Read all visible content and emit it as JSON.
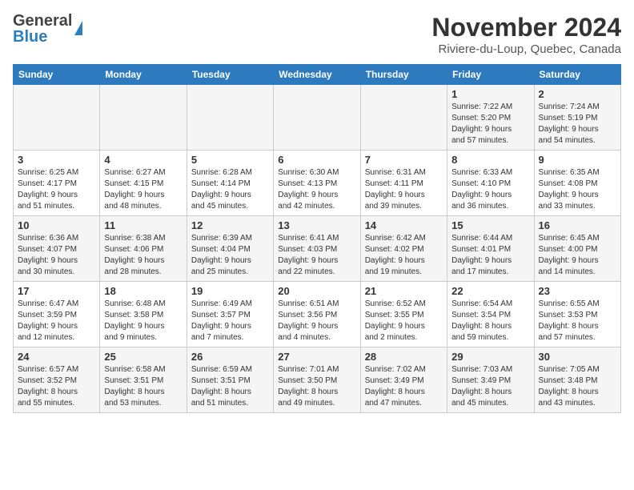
{
  "header": {
    "logo_general": "General",
    "logo_blue": "Blue",
    "month_title": "November 2024",
    "location": "Riviere-du-Loup, Quebec, Canada"
  },
  "weekdays": [
    "Sunday",
    "Monday",
    "Tuesday",
    "Wednesday",
    "Thursday",
    "Friday",
    "Saturday"
  ],
  "weeks": [
    [
      {
        "day": "",
        "info": ""
      },
      {
        "day": "",
        "info": ""
      },
      {
        "day": "",
        "info": ""
      },
      {
        "day": "",
        "info": ""
      },
      {
        "day": "",
        "info": ""
      },
      {
        "day": "1",
        "info": "Sunrise: 7:22 AM\nSunset: 5:20 PM\nDaylight: 9 hours\nand 57 minutes."
      },
      {
        "day": "2",
        "info": "Sunrise: 7:24 AM\nSunset: 5:19 PM\nDaylight: 9 hours\nand 54 minutes."
      }
    ],
    [
      {
        "day": "3",
        "info": "Sunrise: 6:25 AM\nSunset: 4:17 PM\nDaylight: 9 hours\nand 51 minutes."
      },
      {
        "day": "4",
        "info": "Sunrise: 6:27 AM\nSunset: 4:15 PM\nDaylight: 9 hours\nand 48 minutes."
      },
      {
        "day": "5",
        "info": "Sunrise: 6:28 AM\nSunset: 4:14 PM\nDaylight: 9 hours\nand 45 minutes."
      },
      {
        "day": "6",
        "info": "Sunrise: 6:30 AM\nSunset: 4:13 PM\nDaylight: 9 hours\nand 42 minutes."
      },
      {
        "day": "7",
        "info": "Sunrise: 6:31 AM\nSunset: 4:11 PM\nDaylight: 9 hours\nand 39 minutes."
      },
      {
        "day": "8",
        "info": "Sunrise: 6:33 AM\nSunset: 4:10 PM\nDaylight: 9 hours\nand 36 minutes."
      },
      {
        "day": "9",
        "info": "Sunrise: 6:35 AM\nSunset: 4:08 PM\nDaylight: 9 hours\nand 33 minutes."
      }
    ],
    [
      {
        "day": "10",
        "info": "Sunrise: 6:36 AM\nSunset: 4:07 PM\nDaylight: 9 hours\nand 30 minutes."
      },
      {
        "day": "11",
        "info": "Sunrise: 6:38 AM\nSunset: 4:06 PM\nDaylight: 9 hours\nand 28 minutes."
      },
      {
        "day": "12",
        "info": "Sunrise: 6:39 AM\nSunset: 4:04 PM\nDaylight: 9 hours\nand 25 minutes."
      },
      {
        "day": "13",
        "info": "Sunrise: 6:41 AM\nSunset: 4:03 PM\nDaylight: 9 hours\nand 22 minutes."
      },
      {
        "day": "14",
        "info": "Sunrise: 6:42 AM\nSunset: 4:02 PM\nDaylight: 9 hours\nand 19 minutes."
      },
      {
        "day": "15",
        "info": "Sunrise: 6:44 AM\nSunset: 4:01 PM\nDaylight: 9 hours\nand 17 minutes."
      },
      {
        "day": "16",
        "info": "Sunrise: 6:45 AM\nSunset: 4:00 PM\nDaylight: 9 hours\nand 14 minutes."
      }
    ],
    [
      {
        "day": "17",
        "info": "Sunrise: 6:47 AM\nSunset: 3:59 PM\nDaylight: 9 hours\nand 12 minutes."
      },
      {
        "day": "18",
        "info": "Sunrise: 6:48 AM\nSunset: 3:58 PM\nDaylight: 9 hours\nand 9 minutes."
      },
      {
        "day": "19",
        "info": "Sunrise: 6:49 AM\nSunset: 3:57 PM\nDaylight: 9 hours\nand 7 minutes."
      },
      {
        "day": "20",
        "info": "Sunrise: 6:51 AM\nSunset: 3:56 PM\nDaylight: 9 hours\nand 4 minutes."
      },
      {
        "day": "21",
        "info": "Sunrise: 6:52 AM\nSunset: 3:55 PM\nDaylight: 9 hours\nand 2 minutes."
      },
      {
        "day": "22",
        "info": "Sunrise: 6:54 AM\nSunset: 3:54 PM\nDaylight: 8 hours\nand 59 minutes."
      },
      {
        "day": "23",
        "info": "Sunrise: 6:55 AM\nSunset: 3:53 PM\nDaylight: 8 hours\nand 57 minutes."
      }
    ],
    [
      {
        "day": "24",
        "info": "Sunrise: 6:57 AM\nSunset: 3:52 PM\nDaylight: 8 hours\nand 55 minutes."
      },
      {
        "day": "25",
        "info": "Sunrise: 6:58 AM\nSunset: 3:51 PM\nDaylight: 8 hours\nand 53 minutes."
      },
      {
        "day": "26",
        "info": "Sunrise: 6:59 AM\nSunset: 3:51 PM\nDaylight: 8 hours\nand 51 minutes."
      },
      {
        "day": "27",
        "info": "Sunrise: 7:01 AM\nSunset: 3:50 PM\nDaylight: 8 hours\nand 49 minutes."
      },
      {
        "day": "28",
        "info": "Sunrise: 7:02 AM\nSunset: 3:49 PM\nDaylight: 8 hours\nand 47 minutes."
      },
      {
        "day": "29",
        "info": "Sunrise: 7:03 AM\nSunset: 3:49 PM\nDaylight: 8 hours\nand 45 minutes."
      },
      {
        "day": "30",
        "info": "Sunrise: 7:05 AM\nSunset: 3:48 PM\nDaylight: 8 hours\nand 43 minutes."
      }
    ]
  ]
}
